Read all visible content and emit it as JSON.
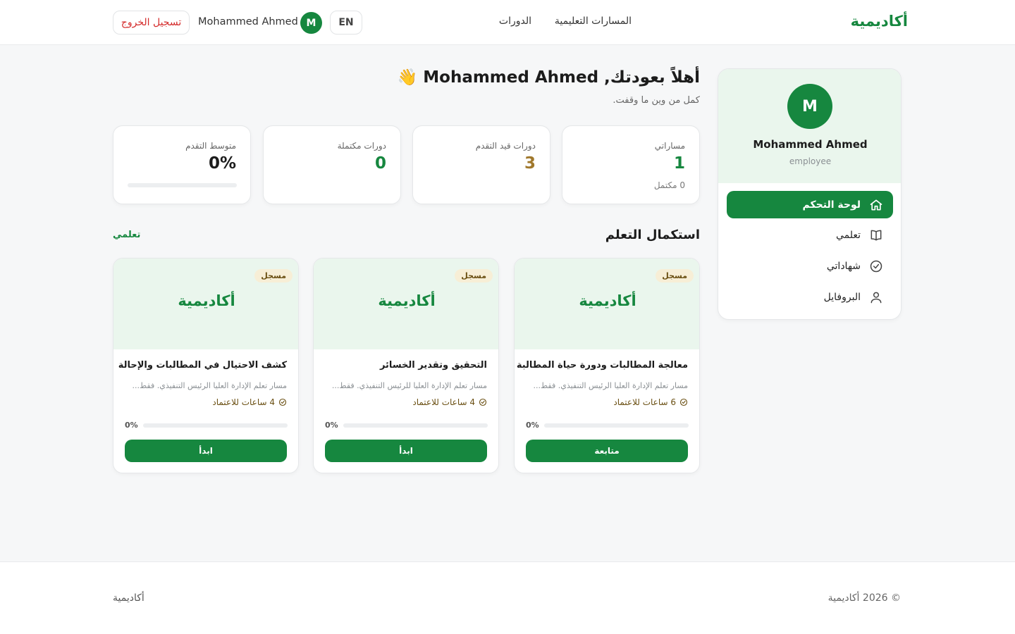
{
  "header": {
    "logo": "أكاديمية",
    "nav": [
      "المسارات التعليمية",
      "الدورات"
    ],
    "user_name": "Mohammed Ahmed",
    "avatar_initial": "M",
    "lang": "EN",
    "logout": "تسجيل الخروج"
  },
  "sidebar": {
    "avatar_initial": "M",
    "name": "Mohammed Ahmed",
    "role": "employee",
    "items": [
      {
        "label": "لوحة التحكم",
        "icon": "home-icon",
        "active": true
      },
      {
        "label": "تعلمي",
        "icon": "book-icon",
        "active": false
      },
      {
        "label": "شهاداتي",
        "icon": "check-circle-icon",
        "active": false
      },
      {
        "label": "البروفايل",
        "icon": "user-icon",
        "active": false
      }
    ]
  },
  "welcome": {
    "title": "أهلاً بعودتك, Mohammed Ahmed 👋",
    "subtitle": "كمل من وين ما وقفت."
  },
  "stats": [
    {
      "label": "مساراتي",
      "value": "1",
      "note": "0 مكتمل",
      "color": "#16873f"
    },
    {
      "label": "دورات قيد التقدم",
      "value": "3",
      "color": "#a0782c"
    },
    {
      "label": "دورات مكتملة",
      "value": "0",
      "color": "#16873f"
    },
    {
      "label": "متوسط التقدم",
      "value": "0%",
      "color": "#1c1c1c",
      "progress": 0
    }
  ],
  "section": {
    "title": "استكمال التعلم",
    "link": "تعلمي"
  },
  "courses": [
    {
      "badge": "مسجل",
      "brand": "أكاديمية",
      "title": "معالجة المطالبات ودورة حياة المطالبة",
      "desc": "مسار تعلم الإدارة العليا الرئيس التنفيذي. فقط...",
      "hours": "6 ساعات للاعتماد",
      "pct": "0%",
      "progress": 0,
      "button": "متابعة"
    },
    {
      "badge": "مسجل",
      "brand": "أكاديمية",
      "title": "التحقيق وتقدير الخسائر",
      "desc": "مسار تعلم الإدارة العليا للرئيس التنفيذي. فقط...",
      "hours": "4 ساعات للاعتماد",
      "pct": "0%",
      "progress": 0,
      "button": "ابدأ"
    },
    {
      "badge": "مسجل",
      "brand": "أكاديمية",
      "title": "كشف الاحتيال في المطالبات والإحالة",
      "desc": "مسار تعلم الإدارة العليا الرئيس التنفيذي. فقط...",
      "hours": "4 ساعات للاعتماد",
      "pct": "0%",
      "progress": 0,
      "button": "ابدأ"
    }
  ],
  "footer": {
    "brand": "أكاديمية",
    "copyright": "© 2026 أكاديمية"
  },
  "colors": {
    "primary": "#16873f",
    "danger": "#d42b2b",
    "accent_light": "#eaf6ed"
  }
}
